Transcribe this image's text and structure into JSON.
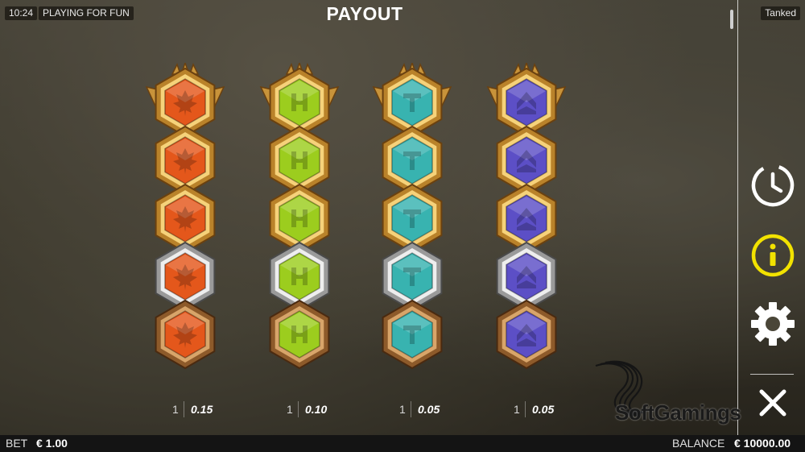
{
  "status": {
    "time": "10:24",
    "mode": "PLAYING FOR FUN",
    "game_name": "Tanked"
  },
  "title": "PAYOUT",
  "symbols": [
    {
      "color": "#e4571b",
      "glyph": "leaf",
      "count": "1",
      "payout": "0.15"
    },
    {
      "color": "#9ccd1e",
      "glyph": "H",
      "count": "1",
      "payout": "0.10"
    },
    {
      "color": "#38b3b0",
      "glyph": "T",
      "count": "1",
      "payout": "0.05"
    },
    {
      "color": "#5c4fc6",
      "glyph": "chevron",
      "count": "1",
      "payout": "0.05"
    }
  ],
  "side_menu": {
    "history_icon": "clock-icon",
    "info_icon": "info-icon",
    "settings_icon": "gear-icon",
    "close_icon": "close-icon",
    "info_color": "#f2e200"
  },
  "watermark": "SoftGamings",
  "bottom_bar": {
    "bet_label": "BET",
    "bet_value": "€ 1.00",
    "balance_label": "BALANCE",
    "balance_value": "€ 10000.00"
  }
}
